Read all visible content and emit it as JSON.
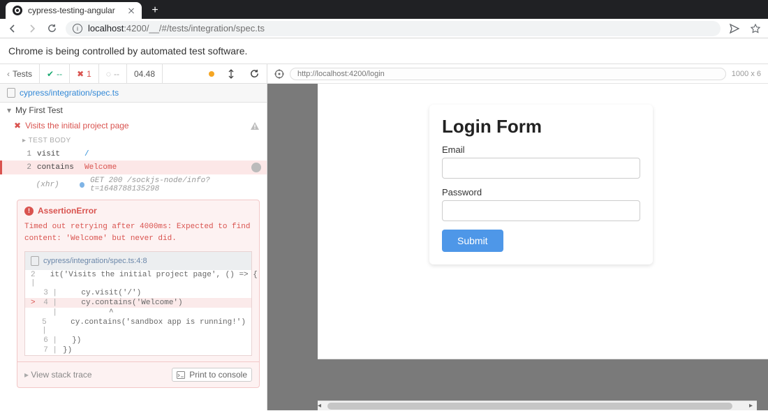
{
  "browser": {
    "tab_title": "cypress-testing-angular",
    "url_host": "localhost",
    "url_port": ":4200",
    "url_path": "/__/#/tests/integration/spec.ts",
    "banner": "Chrome is being controlled by automated test software."
  },
  "cy_header": {
    "tests_label": "Tests",
    "pass_count": "--",
    "fail_count": "1",
    "pending_count": "--",
    "duration": "04.48"
  },
  "crumb": "cypress/integration/spec.ts",
  "tree": {
    "describe": "My First Test",
    "it": "Visits the initial project page",
    "body_label": "TEST BODY"
  },
  "commands": [
    {
      "num": "1",
      "name": "visit",
      "arg": "/"
    },
    {
      "num": "2",
      "name": "contains",
      "arg": "Welcome"
    },
    {
      "num": "",
      "name": "(xhr)",
      "arg": "GET 200 /sockjs-node/info?t=1648788135298"
    }
  ],
  "error": {
    "title": "AssertionError",
    "message": "Timed out retrying after 4000ms: Expected to find content: 'Welcome' but never did.",
    "file": "cypress/integration/spec.ts:4:8",
    "lines": [
      {
        "n": "2",
        "ptr": " ",
        "src": "  it('Visits the initial project page', () => {"
      },
      {
        "n": "3",
        "ptr": " ",
        "src": "    cy.visit('/')"
      },
      {
        "n": "4",
        "ptr": ">",
        "src": "    cy.contains('Welcome')"
      },
      {
        "n": " ",
        "ptr": " ",
        "src": "          ^"
      },
      {
        "n": "5",
        "ptr": " ",
        "src": "    cy.contains('sandbox app is running!')"
      },
      {
        "n": "6",
        "ptr": " ",
        "src": "  })"
      },
      {
        "n": "7",
        "ptr": " ",
        "src": "})"
      }
    ],
    "stack_label": "View stack trace",
    "print_label": "Print to console"
  },
  "iframe": {
    "url": "http://localhost:4200/login",
    "dims": "1000 x 6"
  },
  "login": {
    "title": "Login Form",
    "email_label": "Email",
    "password_label": "Password",
    "submit_label": "Submit"
  }
}
